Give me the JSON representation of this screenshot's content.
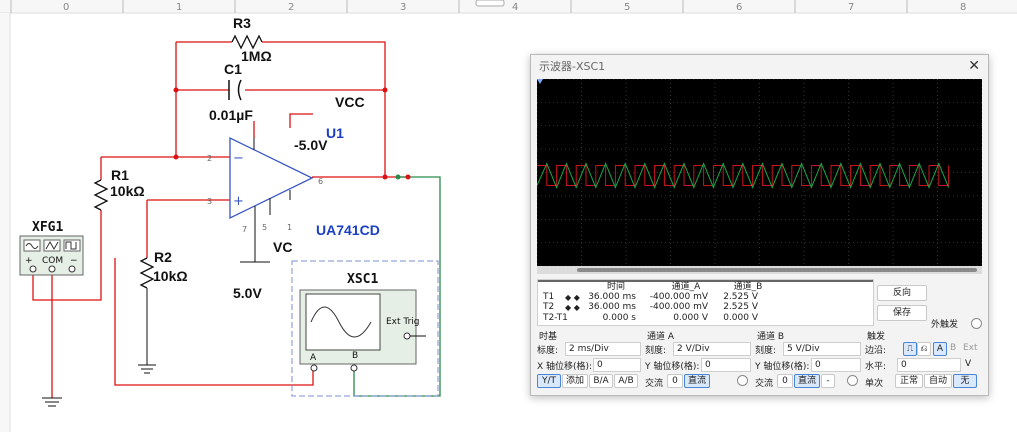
{
  "ruler": {
    "marks": [
      "0",
      "1",
      "2",
      "3",
      "4",
      "5",
      "6",
      "7",
      "8"
    ]
  },
  "schematic": {
    "r3": {
      "name": "R3",
      "value": "1MΩ"
    },
    "c1": {
      "name": "C1",
      "value": "0.01µF"
    },
    "vcc": "VCC",
    "u1": {
      "name": "U1",
      "model": "UA741CD",
      "neg_supply": "-5.0V"
    },
    "r1": {
      "name": "R1",
      "value": "10kΩ"
    },
    "r2": {
      "name": "R2",
      "value": "10kΩ"
    },
    "vc": "VC",
    "supply_5v": "5.0V",
    "xfg1": {
      "name": "XFG1",
      "plus": "+",
      "com": "COM",
      "minus": "−"
    },
    "xsc1": {
      "name": "XSC1",
      "ext_trig": "Ext Trig",
      "a": "A",
      "b": "B"
    },
    "pins": {
      "p2": "2",
      "p3": "3",
      "p6": "6",
      "p7": "7",
      "p5": "5",
      "p1": "1",
      "p4": "4"
    }
  },
  "scope": {
    "title": "示波器-XSC1",
    "close": "✕",
    "meas": {
      "headers": {
        "time": "时间",
        "cha": "通道_A",
        "chb": "通道_B"
      },
      "rows": [
        {
          "label": "T1",
          "time": "36.000 ms",
          "cha": "-400.000 mV",
          "chb": "2.525 V"
        },
        {
          "label": "T2",
          "time": "36.000 ms",
          "cha": "-400.000 mV",
          "chb": "2.525 V"
        },
        {
          "label": "T2-T1",
          "time": "0.000 s",
          "cha": "0.000 V",
          "chb": "0.000 V"
        }
      ],
      "arrows": "◆ ◆"
    },
    "reverse": "反向",
    "save": "保存",
    "ext_trigger": "外触发",
    "timebase": {
      "title": "时基",
      "scale_lbl": "标度:",
      "scale": "2 ms/Div",
      "xpos_lbl": "X 轴位移(格):",
      "xpos": "0",
      "yt": "Y/T",
      "add": "添加",
      "ba": "B/A",
      "ab": "A/B"
    },
    "cha": {
      "title": "通道 A",
      "scale_lbl": "刻度:",
      "scale": "2  V/Div",
      "ypos_lbl": "Y 轴位移(格):",
      "ypos": "0",
      "ac": "交流",
      "zero": "0",
      "dc": "直流"
    },
    "chb": {
      "title": "通道 B",
      "scale_lbl": "刻度:",
      "scale": "5  V/Div",
      "ypos_lbl": "Y 轴位移(格):",
      "ypos": "0",
      "ac": "交流",
      "zero": "0",
      "dc": "直流",
      "minus": "-"
    },
    "trigger": {
      "title": "触发",
      "edge_lbl": "边沿:",
      "a": "A",
      "b": "B",
      "ext": "Ext",
      "level_lbl": "水平:",
      "level": "0",
      "unit": "V",
      "single": "单次",
      "normal": "正常",
      "auto": "自动",
      "none": "无"
    },
    "colors": {
      "cha": "#c8141e",
      "chb": "#17a34a",
      "screen": "#000000",
      "grid": "#555555"
    }
  }
}
